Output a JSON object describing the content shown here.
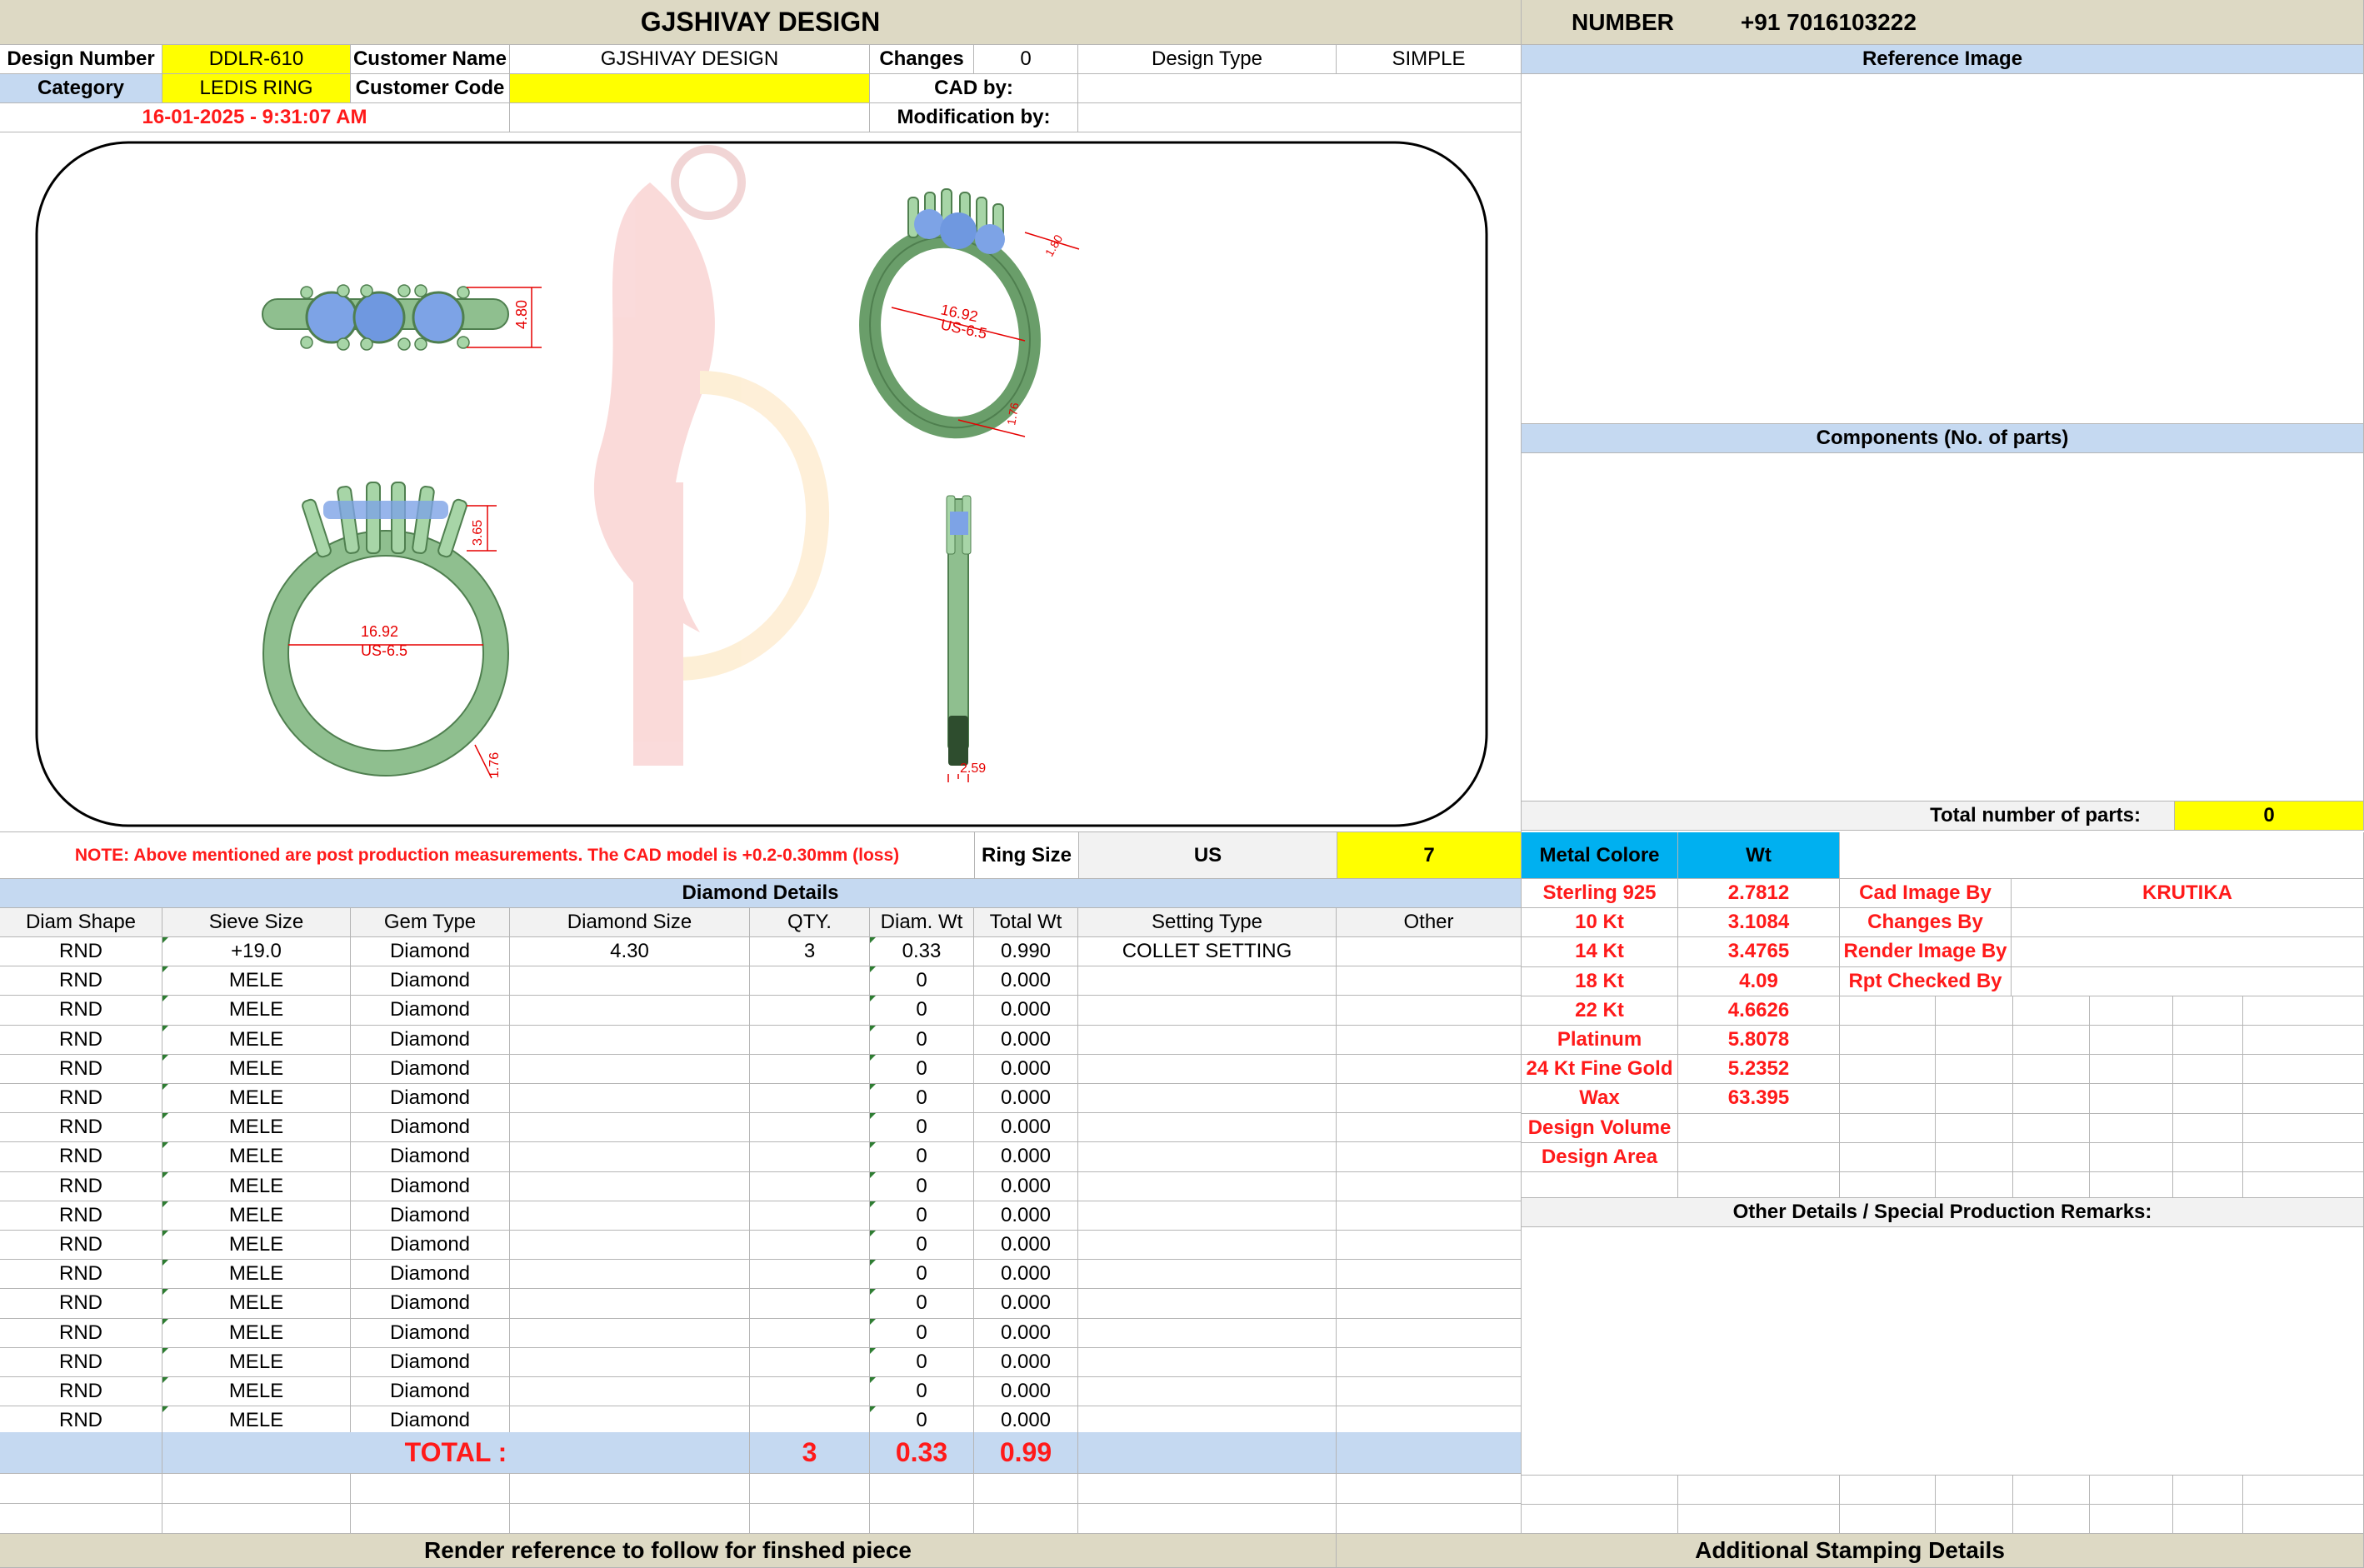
{
  "header": {
    "title": "GJSHIVAY DESIGN",
    "number_label": "NUMBER",
    "number_value": "+91 7016103222"
  },
  "info": {
    "design_number_label": "Design Number",
    "design_number": "DDLR-610",
    "customer_name_label": "Customer Name",
    "customer_name": "GJSHIVAY DESIGN",
    "changes_label": "Changes",
    "changes_value": "0",
    "design_type_label": "Design Type",
    "design_type": "SIMPLE",
    "category_label": "Category",
    "category": "LEDIS RING",
    "customer_code_label": "Customer Code",
    "customer_code": "",
    "cad_by_label": "CAD by:",
    "cad_by": "",
    "date": "16-01-2025 - 9:31:07 AM",
    "modification_by_label": "Modification by:",
    "modification_by": ""
  },
  "drawing": {
    "top_height": "4.80",
    "persp_diameter": "16.92",
    "persp_size": "US-6.5",
    "persp_small1": "1.80",
    "persp_small2": "1.76",
    "front_diameter": "16.92",
    "front_size": "US-6.5",
    "front_height": "3.65",
    "front_band": "1.76",
    "side_width": "2.59"
  },
  "right_panel": {
    "reference_image_label": "Reference Image",
    "components_label": "Components (No. of parts)",
    "total_parts_label": "Total number of parts:",
    "total_parts_value": "0"
  },
  "note": "NOTE: Above mentioned are post production measurements. The CAD model is +0.2-0.30mm (loss)",
  "ring_size": {
    "label": "Ring Size",
    "unit": "US",
    "value": "7"
  },
  "diamond": {
    "section_title": "Diamond Details",
    "headers": [
      "Diam Shape",
      "Sieve Size",
      "Gem Type",
      "Diamond Size",
      "QTY.",
      "Diam. Wt",
      "Total Wt",
      "Setting Type",
      "Other"
    ],
    "rows": [
      [
        "RND",
        "+19.0",
        "Diamond",
        "4.30",
        "3",
        "0.33",
        "0.990",
        "COLLET SETTING",
        ""
      ],
      [
        "RND",
        "MELE",
        "Diamond",
        "",
        "",
        "0",
        "0.000",
        "",
        ""
      ],
      [
        "RND",
        "MELE",
        "Diamond",
        "",
        "",
        "0",
        "0.000",
        "",
        ""
      ],
      [
        "RND",
        "MELE",
        "Diamond",
        "",
        "",
        "0",
        "0.000",
        "",
        ""
      ],
      [
        "RND",
        "MELE",
        "Diamond",
        "",
        "",
        "0",
        "0.000",
        "",
        ""
      ],
      [
        "RND",
        "MELE",
        "Diamond",
        "",
        "",
        "0",
        "0.000",
        "",
        ""
      ],
      [
        "RND",
        "MELE",
        "Diamond",
        "",
        "",
        "0",
        "0.000",
        "",
        ""
      ],
      [
        "RND",
        "MELE",
        "Diamond",
        "",
        "",
        "0",
        "0.000",
        "",
        ""
      ],
      [
        "RND",
        "MELE",
        "Diamond",
        "",
        "",
        "0",
        "0.000",
        "",
        ""
      ],
      [
        "RND",
        "MELE",
        "Diamond",
        "",
        "",
        "0",
        "0.000",
        "",
        ""
      ],
      [
        "RND",
        "MELE",
        "Diamond",
        "",
        "",
        "0",
        "0.000",
        "",
        ""
      ],
      [
        "RND",
        "MELE",
        "Diamond",
        "",
        "",
        "0",
        "0.000",
        "",
        ""
      ],
      [
        "RND",
        "MELE",
        "Diamond",
        "",
        "",
        "0",
        "0.000",
        "",
        ""
      ],
      [
        "RND",
        "MELE",
        "Diamond",
        "",
        "",
        "0",
        "0.000",
        "",
        ""
      ],
      [
        "RND",
        "MELE",
        "Diamond",
        "",
        "",
        "0",
        "0.000",
        "",
        ""
      ],
      [
        "RND",
        "MELE",
        "Diamond",
        "",
        "",
        "0",
        "0.000",
        "",
        ""
      ],
      [
        "RND",
        "MELE",
        "Diamond",
        "",
        "",
        "0",
        "0.000",
        "",
        ""
      ]
    ],
    "total_label": "TOTAL :",
    "total_qty": "3",
    "total_diam_wt": "0.33",
    "total_wt": "0.99"
  },
  "metal": {
    "color_label": "Metal Colore",
    "wt_label": "Wt",
    "rows": [
      [
        "Sterling 925",
        "2.7812"
      ],
      [
        "10 Kt",
        "3.1084"
      ],
      [
        "14 Kt",
        "3.4765"
      ],
      [
        "18 Kt",
        "4.09"
      ],
      [
        "22 Kt",
        "4.6626"
      ],
      [
        "Platinum",
        "5.8078"
      ],
      [
        "24 Kt Fine Gold",
        "5.2352"
      ],
      [
        "Wax",
        "63.395"
      ],
      [
        "Design Volume",
        ""
      ],
      [
        "Design Area",
        ""
      ]
    ]
  },
  "credits": {
    "rows": [
      [
        "Cad Image By",
        "KRUTIKA"
      ],
      [
        "Changes By",
        ""
      ],
      [
        "Render Image By",
        ""
      ],
      [
        "Rpt Checked By",
        ""
      ]
    ]
  },
  "other_details_label": "Other Details / Special Production Remarks:",
  "footer": {
    "render_reference": "Render reference to follow for finshed piece",
    "stamping": "Additional Stamping Details"
  }
}
